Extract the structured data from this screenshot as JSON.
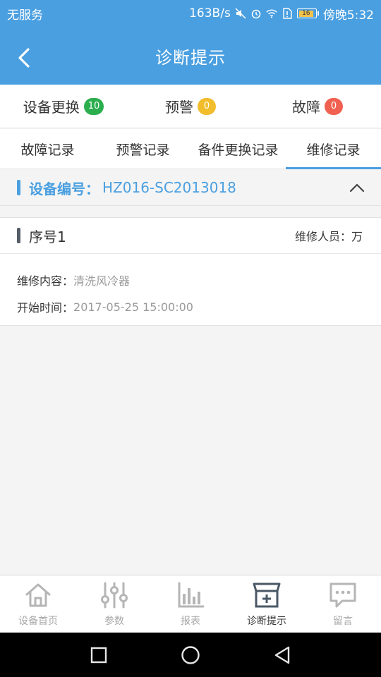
{
  "status_bar": {
    "carrier": "无服务",
    "speed": "163B/s",
    "battery": "16",
    "time": "傍晚5:32"
  },
  "header": {
    "title": "诊断提示"
  },
  "summary": [
    {
      "label": "设备更换",
      "count": "10",
      "color": "#2cae4f"
    },
    {
      "label": "预警",
      "count": "0",
      "color": "#f2bd2c"
    },
    {
      "label": "故障",
      "count": "0",
      "color": "#f06151"
    }
  ],
  "record_tabs": [
    {
      "label": "故障记录"
    },
    {
      "label": "预警记录"
    },
    {
      "label": "备件更换记录"
    },
    {
      "label": "维修记录"
    }
  ],
  "active_record_tab": "维修记录",
  "device": {
    "label": "设备编号：",
    "code": "HZ016-SC2013018"
  },
  "record": {
    "seq": "序号1",
    "person_label": "维修人员：",
    "person": "万",
    "content_label": "维修内容：",
    "content": "清洗风冷器",
    "start_label": "开始时间：",
    "start": "2017-05-25 15:00:00"
  },
  "bottom_nav": [
    {
      "label": "设备首页",
      "icon": "home-icon"
    },
    {
      "label": "参数",
      "icon": "sliders-icon"
    },
    {
      "label": "报表",
      "icon": "bar-chart-icon"
    },
    {
      "label": "诊断提示",
      "icon": "diagnosis-store-icon"
    },
    {
      "label": "留言",
      "icon": "message-icon"
    }
  ],
  "active_nav": "诊断提示",
  "colors": {
    "primary": "#4a9fe0",
    "active_icon": "#4a5866",
    "inactive_icon": "#b5b5b5"
  }
}
